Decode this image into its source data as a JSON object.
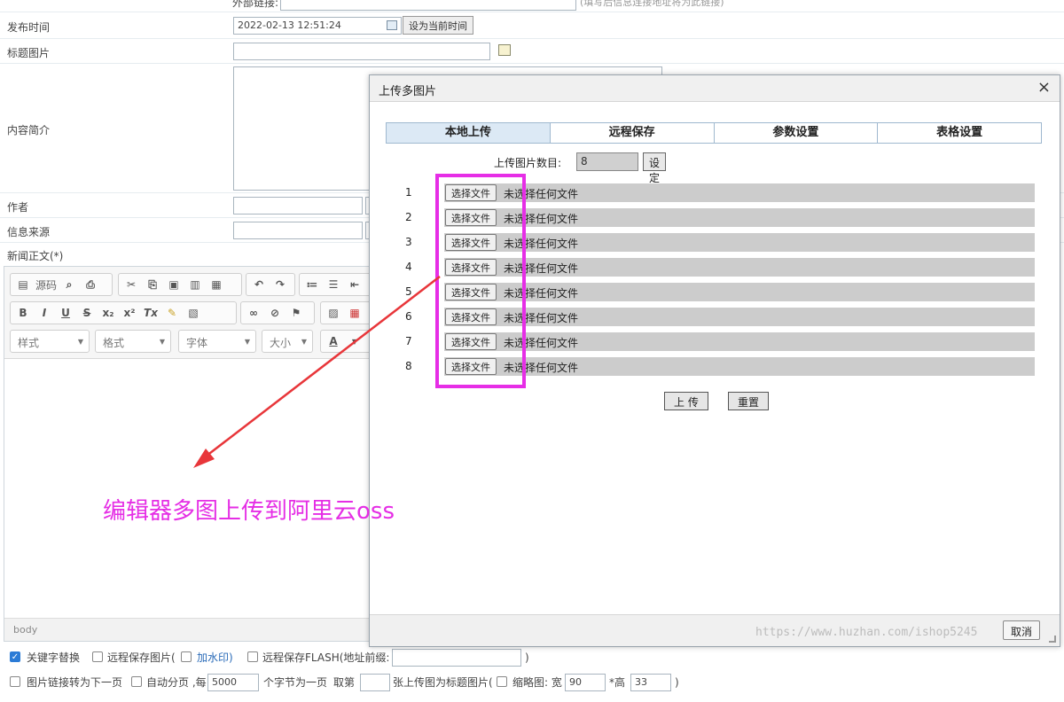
{
  "form": {
    "external_link_label": "外部链接:",
    "external_link_hint": "(填写后信息连接地址将为此链接)",
    "publish_time_label": "发布时间",
    "publish_time_value": "2022-02-13 12:51:24",
    "set_current_time": "设为当前时间",
    "title_image_label": "标题图片",
    "summary_label": "内容简介",
    "author_label": "作者",
    "source_label": "信息来源",
    "body_label": "新闻正文(*)"
  },
  "editor": {
    "source_label": "源码",
    "bold": "B",
    "italic": "I",
    "underline": "U",
    "strike": "S",
    "subscript": "x₂",
    "superscript": "x²",
    "clear": "Tx",
    "style_combo": "样式",
    "format_combo": "格式",
    "font_combo": "字体",
    "size_combo": "大小",
    "color_label": "A",
    "path": "body"
  },
  "options": {
    "keyword_replace": "关键字替换",
    "remote_save_image": "远程保存图片(",
    "watermark": "加水印)",
    "remote_save_flash": "远程保存FLASH(地址前缀:",
    "close_paren": ")",
    "image_link_next": "图片链接转为下一页",
    "auto_paging": "自动分页 ,每",
    "paging_chars": "5000",
    "chars_per_page": "个字节为一页",
    "take_label": "取第",
    "title_image_text": "张上传图为标题图片(",
    "thumbnail_label": "缩略图: 宽",
    "thumb_width": "90",
    "height_label": "*高",
    "thumb_height": "33",
    "end_paren": ")"
  },
  "dialog": {
    "title": "上传多图片",
    "close": "×",
    "tabs": [
      "本地上传",
      "远程保存",
      "参数设置",
      "表格设置"
    ],
    "count_label": "上传图片数目:",
    "count_value": "8",
    "set_button": "设定",
    "choose_file": "选择文件",
    "no_file": "未选择任何文件",
    "rows": [
      "1",
      "2",
      "3",
      "4",
      "5",
      "6",
      "7",
      "8"
    ],
    "upload_button": "上 传",
    "reset_button": "重置",
    "cancel_button": "取消"
  },
  "watermark_text": "https://www.huzhan.com/ishop5245",
  "annotation_text": "编辑器多图上传到阿里云oss",
  "colors": {
    "highlight": "#e62ee6",
    "arrow": "#e8363a",
    "active_tab": "#dce9f5"
  }
}
